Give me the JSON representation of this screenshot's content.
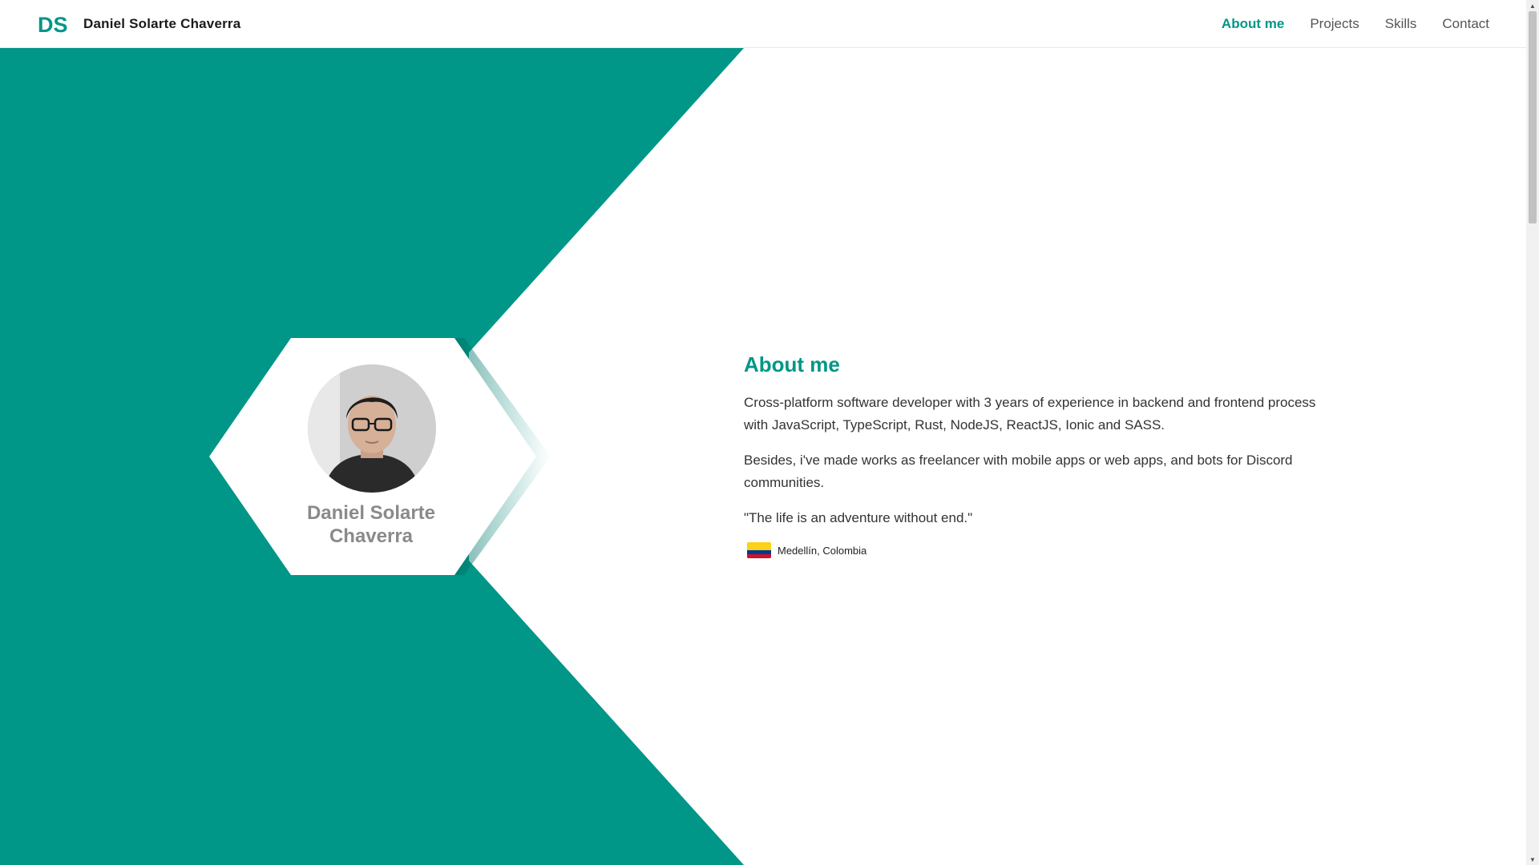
{
  "brand": {
    "logo_text": "DS",
    "name": "Daniel Solarte Chaverra"
  },
  "nav": {
    "items": [
      {
        "label": "About me",
        "active": true
      },
      {
        "label": "Projects",
        "active": false
      },
      {
        "label": "Skills",
        "active": false
      },
      {
        "label": "Contact",
        "active": false
      }
    ]
  },
  "profile": {
    "name_line1": "Daniel Solarte",
    "name_line2": "Chaverra",
    "avatar_icon": "profile-photo"
  },
  "about": {
    "title": "About me",
    "paragraph1": "Cross-platform software developer with 3 years of experience in backend and frontend process with JavaScript, TypeScript, Rust, NodeJS, ReactJS, Ionic and SASS.",
    "paragraph2": "Besides, i've made works as freelancer with mobile apps or web apps, and bots for Discord communities.",
    "quote": "\"The life is an adventure without end.\"",
    "location": "Medellín, Colombia",
    "flag_icon": "colombia-flag-icon"
  },
  "colors": {
    "accent": "#009688",
    "text": "#333333",
    "name_gray": "#8a8a8a",
    "flag_yellow": "#FCD116",
    "flag_blue": "#003893",
    "flag_red": "#CE1126"
  }
}
